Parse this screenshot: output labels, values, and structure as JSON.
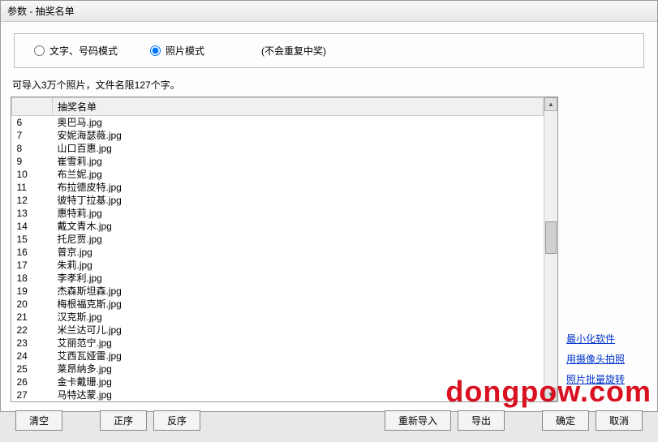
{
  "titlebar": "参数 - 抽奖名单",
  "modes": {
    "text_mode": {
      "label": "文字、号码模式",
      "checked": false
    },
    "photo_mode": {
      "label": "照片模式",
      "checked": true
    },
    "hint": "(不会重复中奖)"
  },
  "import_hint": "可导入3万个照片，文件名限127个字。",
  "table": {
    "headers": {
      "blank": "",
      "name": "抽奖名单"
    },
    "rows": [
      {
        "num": "6",
        "name": "奥巴马.jpg"
      },
      {
        "num": "7",
        "name": "安妮海瑟薇.jpg"
      },
      {
        "num": "8",
        "name": "山口百惠.jpg"
      },
      {
        "num": "9",
        "name": "崔雪莉.jpg"
      },
      {
        "num": "10",
        "name": "布兰妮.jpg"
      },
      {
        "num": "11",
        "name": "布拉德皮特.jpg"
      },
      {
        "num": "12",
        "name": "彼特丁拉基.jpg"
      },
      {
        "num": "13",
        "name": "惠特莉.jpg"
      },
      {
        "num": "14",
        "name": "戴文青木.jpg"
      },
      {
        "num": "15",
        "name": "托尼贾.jpg"
      },
      {
        "num": "16",
        "name": "普京.jpg"
      },
      {
        "num": "17",
        "name": "朱莉.jpg"
      },
      {
        "num": "18",
        "name": "李孝利.jpg"
      },
      {
        "num": "19",
        "name": "杰森斯坦森.jpg"
      },
      {
        "num": "20",
        "name": "梅根福克斯.jpg"
      },
      {
        "num": "21",
        "name": "汉克斯.jpg"
      },
      {
        "num": "22",
        "name": "米兰达可儿.jpg"
      },
      {
        "num": "23",
        "name": "艾丽范宁.jpg"
      },
      {
        "num": "24",
        "name": "艾西瓦娅雷.jpg"
      },
      {
        "num": "25",
        "name": "莱昂纳多.jpg"
      },
      {
        "num": "26",
        "name": "金卡戴珊.jpg"
      },
      {
        "num": "27",
        "name": "马特达蒙.jpg"
      }
    ]
  },
  "side_links": {
    "minimize": "最小化软件",
    "camera": "用摄像头拍照",
    "rotate": "照片批量旋转"
  },
  "buttons": {
    "clear": "清空",
    "sort_asc": "正序",
    "sort_desc": "反序",
    "reimport": "重新导入",
    "export": "导出",
    "ok": "确定",
    "cancel": "取消"
  },
  "watermark": "dongpow.com"
}
